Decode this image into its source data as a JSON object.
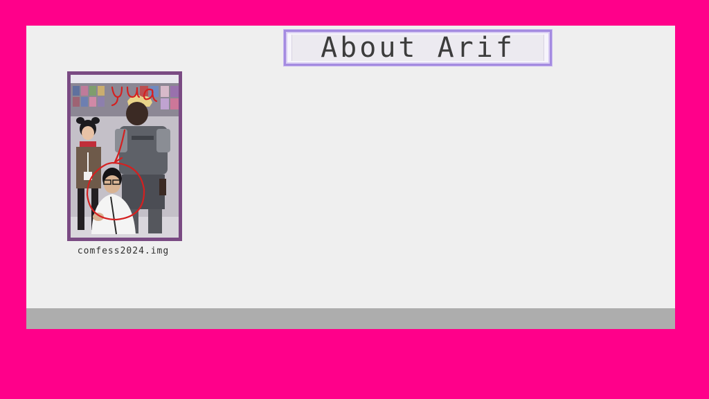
{
  "window": {
    "title": "About Arif"
  },
  "photo": {
    "caption": "comfess2024.img",
    "annotation": "yua"
  },
  "colors": {
    "background": "#ff008a",
    "panel": "#efefef",
    "statusbar": "#adadad",
    "title_border": "#a48be0",
    "photo_frame": "#7a4a83",
    "annotation_ink": "#d42020"
  }
}
